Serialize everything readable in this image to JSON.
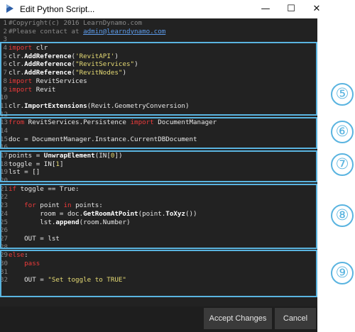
{
  "window": {
    "title": "Edit Python Script...",
    "controls": {
      "minimize": "—",
      "maximize": "☐",
      "close": "✕"
    }
  },
  "editor": {
    "lines": [
      {
        "n": "1",
        "t": [
          {
            "c": "cm",
            "v": "#Copyright(c) 2016 LearnDynamo.com"
          }
        ]
      },
      {
        "n": "2",
        "t": [
          {
            "c": "cm",
            "v": "#Please contact at "
          },
          {
            "c": "lnk",
            "v": "admin@learndynamo.com"
          }
        ]
      },
      {
        "n": "3",
        "t": []
      },
      {
        "n": "4",
        "t": [
          {
            "c": "kw",
            "v": "import"
          },
          {
            "c": "nm",
            "v": " clr"
          }
        ]
      },
      {
        "n": "5",
        "t": [
          {
            "c": "nm",
            "v": "clr."
          },
          {
            "c": "fn",
            "v": "AddReference"
          },
          {
            "c": "nm",
            "v": "("
          },
          {
            "c": "str",
            "v": "'RevitAPI'"
          },
          {
            "c": "nm",
            "v": ")"
          }
        ]
      },
      {
        "n": "6",
        "t": [
          {
            "c": "nm",
            "v": "clr."
          },
          {
            "c": "fn",
            "v": "AddReference"
          },
          {
            "c": "nm",
            "v": "("
          },
          {
            "c": "str",
            "v": "\"RevitServices\""
          },
          {
            "c": "nm",
            "v": ")"
          }
        ]
      },
      {
        "n": "7",
        "t": [
          {
            "c": "nm",
            "v": "clr."
          },
          {
            "c": "fn",
            "v": "AddReference"
          },
          {
            "c": "nm",
            "v": "("
          },
          {
            "c": "str",
            "v": "\"RevitNodes\""
          },
          {
            "c": "nm",
            "v": ")"
          }
        ]
      },
      {
        "n": "8",
        "t": [
          {
            "c": "kw",
            "v": "import"
          },
          {
            "c": "nm",
            "v": " RevitServices"
          }
        ]
      },
      {
        "n": "9",
        "t": [
          {
            "c": "kw",
            "v": "import"
          },
          {
            "c": "nm",
            "v": " Revit"
          }
        ]
      },
      {
        "n": "10",
        "t": []
      },
      {
        "n": "11",
        "t": [
          {
            "c": "nm",
            "v": "clr."
          },
          {
            "c": "fn",
            "v": "ImportExtensions"
          },
          {
            "c": "nm",
            "v": "(Revit.GeometryConversion)"
          }
        ]
      },
      {
        "n": "12",
        "t": []
      },
      {
        "n": "13",
        "t": [
          {
            "c": "kw",
            "v": "from"
          },
          {
            "c": "nm",
            "v": " RevitServices.Persistence "
          },
          {
            "c": "kw",
            "v": "import"
          },
          {
            "c": "nm",
            "v": " DocumentManager"
          }
        ]
      },
      {
        "n": "14",
        "t": []
      },
      {
        "n": "15",
        "t": [
          {
            "c": "nm",
            "v": "doc = DocumentManager.Instance.CurrentDBDocument"
          }
        ]
      },
      {
        "n": "16",
        "t": []
      },
      {
        "n": "17",
        "t": [
          {
            "c": "nm",
            "v": "points = "
          },
          {
            "c": "fn",
            "v": "UnwrapElement"
          },
          {
            "c": "nm",
            "v": "(IN["
          },
          {
            "c": "str",
            "v": "0"
          },
          {
            "c": "nm",
            "v": "])"
          }
        ]
      },
      {
        "n": "18",
        "t": [
          {
            "c": "nm",
            "v": "toggle = IN["
          },
          {
            "c": "str",
            "v": "1"
          },
          {
            "c": "nm",
            "v": "]"
          }
        ]
      },
      {
        "n": "19",
        "t": [
          {
            "c": "nm",
            "v": "lst = []"
          }
        ]
      },
      {
        "n": "20",
        "t": []
      },
      {
        "n": "21",
        "t": [
          {
            "c": "kw",
            "v": "if"
          },
          {
            "c": "nm",
            "v": " toggle == True:"
          }
        ]
      },
      {
        "n": "22",
        "t": []
      },
      {
        "n": "23",
        "t": [
          {
            "c": "nm",
            "v": "    "
          },
          {
            "c": "kw",
            "v": "for"
          },
          {
            "c": "nm",
            "v": " point "
          },
          {
            "c": "kw",
            "v": "in"
          },
          {
            "c": "nm",
            "v": " points:"
          }
        ]
      },
      {
        "n": "24",
        "t": [
          {
            "c": "nm",
            "v": "        room = doc."
          },
          {
            "c": "fn",
            "v": "GetRoomAtPoint"
          },
          {
            "c": "nm",
            "v": "(point."
          },
          {
            "c": "fn",
            "v": "ToXyz"
          },
          {
            "c": "nm",
            "v": "())"
          }
        ]
      },
      {
        "n": "25",
        "t": [
          {
            "c": "nm",
            "v": "        lst."
          },
          {
            "c": "fn",
            "v": "append"
          },
          {
            "c": "nm",
            "v": "(room.Number)"
          }
        ]
      },
      {
        "n": "26",
        "t": []
      },
      {
        "n": "27",
        "t": [
          {
            "c": "nm",
            "v": "    OUT = lst"
          }
        ]
      },
      {
        "n": "28",
        "t": []
      },
      {
        "n": "29",
        "t": [
          {
            "c": "kw",
            "v": "else"
          },
          {
            "c": "nm",
            "v": ":"
          }
        ]
      },
      {
        "n": "30",
        "t": [
          {
            "c": "nm",
            "v": "    "
          },
          {
            "c": "kw",
            "v": "pass"
          }
        ]
      },
      {
        "n": "31",
        "t": []
      },
      {
        "n": "32",
        "t": [
          {
            "c": "nm",
            "v": "    OUT = "
          },
          {
            "c": "str",
            "v": "\"Set toggle to TRUE\""
          }
        ]
      }
    ]
  },
  "annotations": [
    {
      "label": "⑤"
    },
    {
      "label": "⑥"
    },
    {
      "label": "⑦"
    },
    {
      "label": "⑧"
    },
    {
      "label": "⑨"
    }
  ],
  "footer": {
    "accept_label": "Accept Changes",
    "cancel_label": "Cancel"
  },
  "colors": {
    "editor_bg": "#222222",
    "highlight": "#5ab4e0",
    "keyword": "#ef3b3b",
    "string": "#e6db74"
  }
}
